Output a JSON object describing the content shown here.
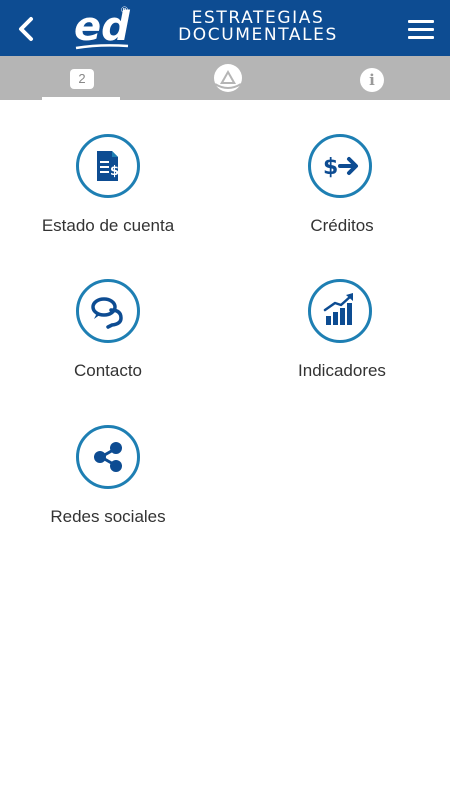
{
  "header": {
    "brand_line1": "ESTRATEGIAS",
    "brand_line2": "DOCUMENTALES",
    "logo_text": "ed",
    "logo_mark": "®",
    "back_icon": "chevron-left-icon",
    "menu_icon": "hamburger-menu-icon"
  },
  "tabs": {
    "badge_count": "2",
    "info_glyph": "i"
  },
  "menu": {
    "items": [
      {
        "label": "Estado de cuenta",
        "icon": "invoice-dollar-icon"
      },
      {
        "label": "Créditos",
        "icon": "dollar-arrow-icon"
      },
      {
        "label": "Contacto",
        "icon": "chat-bubbles-icon"
      },
      {
        "label": "Indicadores",
        "icon": "bar-chart-trend-icon"
      },
      {
        "label": "Redes sociales",
        "icon": "share-icon"
      }
    ]
  },
  "colors": {
    "header_bg": "#0d4c92",
    "tabbar_bg": "#b5b5b5",
    "icon_blue": "#1e7fb3",
    "icon_dark": "#0d4c92"
  }
}
